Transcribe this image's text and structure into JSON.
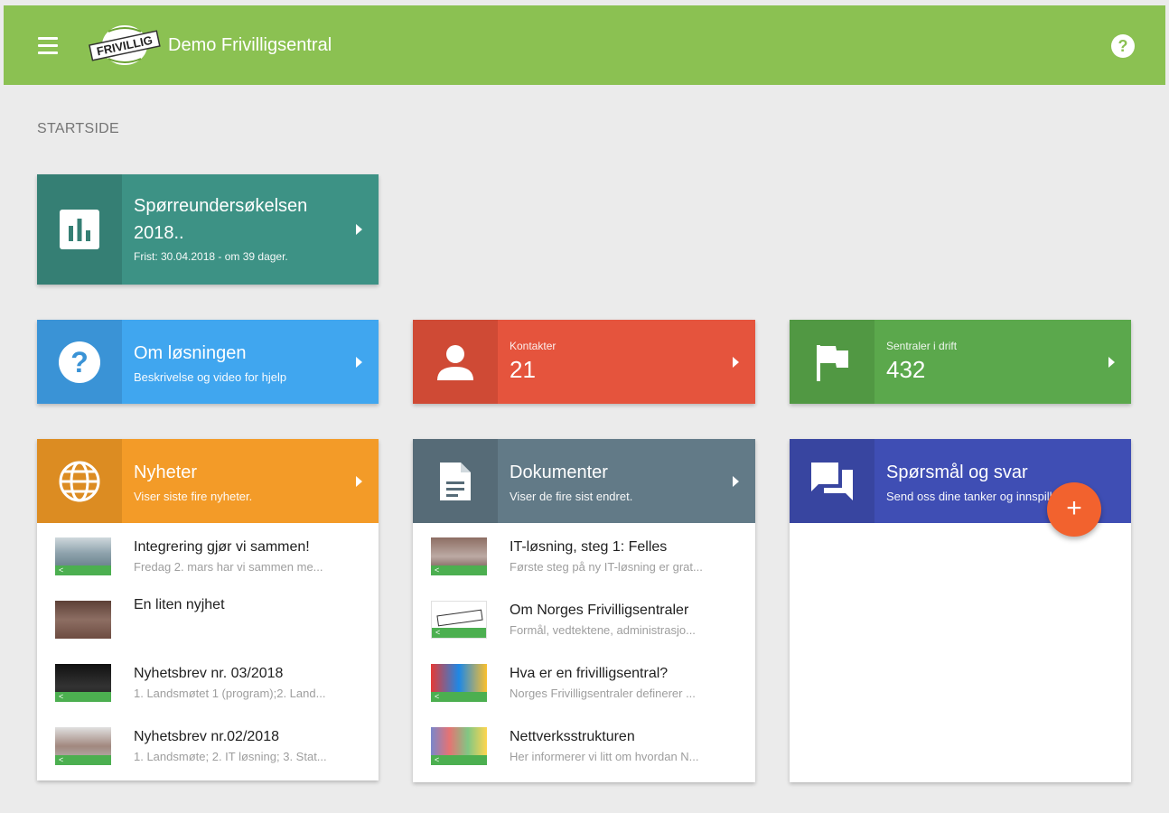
{
  "header": {
    "app_title": "Demo Frivilligsentral",
    "logo_text": "FRIVILLIG",
    "help_label": "?",
    "accent": "#8bc152"
  },
  "breadcrumb": "STARTSIDE",
  "survey": {
    "title": "Spørreundersøkelsen 2018..",
    "subtitle": "Frist: 30.04.2018 - om 39 dager.",
    "color": "#3d9285",
    "icon": "bar-chart-icon"
  },
  "about": {
    "title": "Om løsningen",
    "subtitle": "Beskrivelse og video for hjelp",
    "color": "#40a6ef",
    "icon": "help-circle-icon"
  },
  "contacts": {
    "label": "Kontakter",
    "value": "21",
    "color": "#e5543d",
    "icon": "person-icon"
  },
  "centrals": {
    "label": "Sentraler i drift",
    "value": "432",
    "color": "#5ba84c",
    "icon": "flag-icon"
  },
  "news": {
    "title": "Nyheter",
    "subtitle": "Viser siste fire nyheter.",
    "color": "#f39b28",
    "icon": "globe-icon",
    "items": [
      {
        "title": "Integrering gjør vi sammen!",
        "sub": "Fredag 2. mars har vi sammen me...",
        "share": "<"
      },
      {
        "title": "En liten nyjhet",
        "sub": "",
        "share": ""
      },
      {
        "title": "Nyhetsbrev nr. 03/2018",
        "sub": "1. Landsmøtet 1 (program);2. Land...",
        "share": "<"
      },
      {
        "title": "Nyhetsbrev nr.02/2018",
        "sub": "1. Landsmøte; 2. IT løsning; 3. Stat...",
        "share": "<"
      }
    ]
  },
  "documents": {
    "title": "Dokumenter",
    "subtitle": "Viser de fire sist endret.",
    "color": "#627a87",
    "icon": "document-icon",
    "items": [
      {
        "title": "IT-løsning, steg 1: Felles",
        "sub": "Første steg på ny IT-løsning er grat...",
        "share": "<"
      },
      {
        "title": "Om Norges Frivilligsentraler",
        "sub": "Formål, vedtektene, administrasjo...",
        "share": "<"
      },
      {
        "title": "Hva er en frivilligsentral?",
        "sub": "Norges Frivilligsentraler definerer ...",
        "share": "<"
      },
      {
        "title": "Nettverksstrukturen",
        "sub": "Her informerer vi litt om hvordan N...",
        "share": "<"
      }
    ]
  },
  "qa": {
    "title": "Spørsmål og svar",
    "subtitle": "Send oss dine tanker og innspill",
    "color": "#3f4eb4",
    "icon": "chat-icon",
    "fab_label": "+"
  }
}
